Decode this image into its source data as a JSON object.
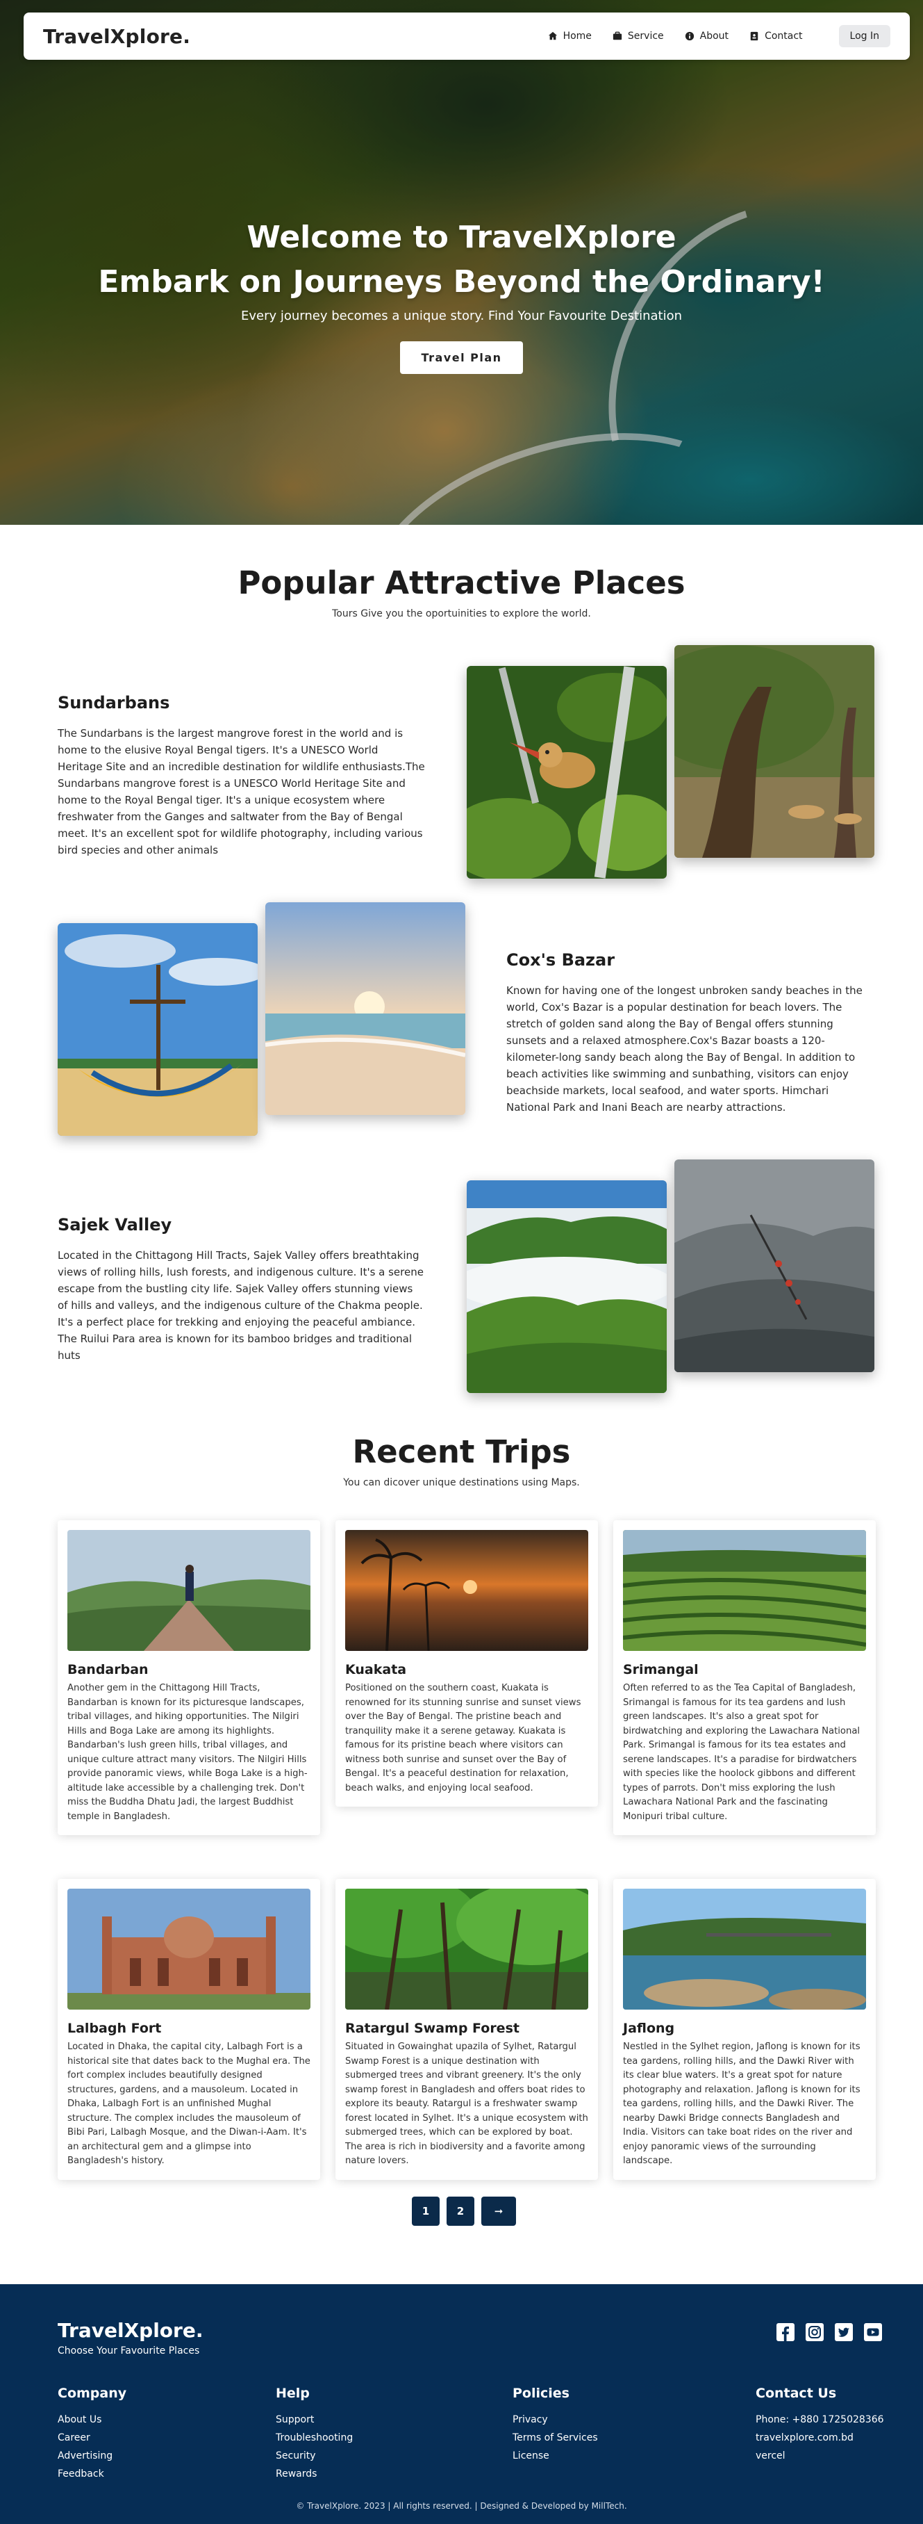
{
  "nav": {
    "brand": "TravelXplore.",
    "items": [
      "Home",
      "Service",
      "About",
      "Contact"
    ],
    "login": "Log In"
  },
  "hero": {
    "title_line1": "Welcome to TravelXplore",
    "title_line2": "Embark on Journeys Beyond the Ordinary!",
    "subtitle": "Every journey becomes a unique story. Find Your Favourite Destination",
    "cta": "Travel Plan"
  },
  "places_section": {
    "title": "Popular Attractive Places",
    "subtitle": "Tours Give you the oportuinities to explore the world.",
    "places": [
      {
        "name": "Sundarbans",
        "description": "The Sundarbans is the largest mangrove forest in the world and is home to the elusive Royal Bengal tigers. It's a UNESCO World Heritage Site and an incredible destination for wildlife enthusiasts.The Sundarbans mangrove forest is a UNESCO World Heritage Site and home to the Royal Bengal tiger. It's a unique ecosystem where freshwater from the Ganges and saltwater from the Bay of Bengal meet. It's an excellent spot for wildlife photography, including various bird species and other animals"
      },
      {
        "name": "Cox's Bazar",
        "description": "Known for having one of the longest unbroken sandy beaches in the world, Cox's Bazar is a popular destination for beach lovers. The stretch of golden sand along the Bay of Bengal offers stunning sunsets and a relaxed atmosphere.Cox's Bazar boasts a 120-kilometer-long sandy beach along the Bay of Bengal. In addition to beach activities like swimming and sunbathing, visitors can enjoy beachside markets, local seafood, and water sports. Himchari National Park and Inani Beach are nearby attractions."
      },
      {
        "name": "Sajek Valley",
        "description": "Located in the Chittagong Hill Tracts, Sajek Valley offers breathtaking views of rolling hills, lush forests, and indigenous culture. It's a serene escape from the bustling city life. Sajek Valley offers stunning views of hills and valleys, and the indigenous culture of the Chakma people. It's a perfect place for trekking and enjoying the peaceful ambiance. The Ruilui Para area is known for its bamboo bridges and traditional huts"
      }
    ]
  },
  "trips_section": {
    "title": "Recent Trips",
    "subtitle": "You can dicover unique destinations using Maps.",
    "trips": [
      {
        "name": "Bandarban",
        "description": " Another gem in the Chittagong Hill Tracts, Bandarban is known for its picturesque landscapes, tribal villages, and hiking opportunities. The Nilgiri Hills and Boga Lake are among its highlights. Bandarban's lush green hills, tribal villages, and unique culture attract many visitors. The Nilgiri Hills provide panoramic views, while Boga Lake is a high-altitude lake accessible by a challenging trek. Don't miss the Buddha Dhatu Jadi, the largest Buddhist temple in Bangladesh."
      },
      {
        "name": "Kuakata",
        "description": "Positioned on the southern coast, Kuakata is renowned for its stunning sunrise and sunset views over the Bay of Bengal. The pristine beach and tranquility make it a serene getaway. Kuakata is famous for its pristine beach where visitors can witness both sunrise and sunset over the Bay of Bengal. It's a peaceful destination for relaxation, beach walks, and enjoying local seafood."
      },
      {
        "name": "Srimangal",
        "description": "Often referred to as the Tea Capital of Bangladesh, Srimangal is famous for its tea gardens and lush green landscapes. It's also a great spot for birdwatching and exploring the Lawachara National Park. Srimangal is famous for its tea estates and serene landscapes. It's a paradise for birdwatchers with species like the hoolock gibbons and different types of parrots. Don't miss exploring the lush Lawachara National Park and the fascinating Monipuri tribal culture."
      },
      {
        "name": "Lalbagh Fort",
        "description": "Located in Dhaka, the capital city, Lalbagh Fort is a historical site that dates back to the Mughal era. The fort complex includes beautifully designed structures, gardens, and a mausoleum. Located in Dhaka, Lalbagh Fort is an unfinished Mughal structure. The complex includes the mausoleum of Bibi Pari, Lalbagh Mosque, and the Diwan-i-Aam. It's an architectural gem and a glimpse into Bangladesh's history."
      },
      {
        "name": "Ratargul Swamp Forest",
        "description": "Situated in Gowainghat upazila of Sylhet, Ratargul Swamp Forest is a unique destination with submerged trees and vibrant greenery. It's the only swamp forest in Bangladesh and offers boat rides to explore its beauty. Ratargul is a freshwater swamp forest located in Sylhet. It's a unique ecosystem with submerged trees, which can be explored by boat. The area is rich in biodiversity and a favorite among nature lovers."
      },
      {
        "name": "Jaflong",
        "description": "Nestled in the Sylhet region, Jaflong is known for its tea gardens, rolling hills, and the Dawki River with its clear blue waters. It's a great spot for nature photography and relaxation. Jaflong is known for its tea gardens, rolling hills, and the Dawki River. The nearby Dawki Bridge connects Bangladesh and India. Visitors can take boat rides on the river and enjoy panoramic views of the surrounding landscape."
      }
    ],
    "pagination": [
      "1",
      "2",
      "➞"
    ]
  },
  "footer": {
    "brand": "TravelXplore.",
    "tagline": "Choose Your Favourite Places",
    "social_icons": [
      "facebook-icon",
      "instagram-icon",
      "twitter-icon",
      "youtube-icon"
    ],
    "columns": [
      {
        "title": "Company",
        "links": [
          "About Us",
          "Career",
          "Advertising",
          "Feedback"
        ]
      },
      {
        "title": "Help",
        "links": [
          "Support",
          "Troubleshooting",
          "Security",
          "Rewards"
        ]
      },
      {
        "title": "Policies",
        "links": [
          "Privacy",
          "Terms of Services",
          "License"
        ]
      },
      {
        "title": "Contact Us",
        "links": [
          "Phone: +880 1725028366",
          "travelxplore.com.bd",
          "vercel"
        ]
      }
    ],
    "copyright": "© TravelXplore. 2023 | All rights reserved. | Designed & Developed by MillTech."
  },
  "colors": {
    "footer_bg": "#062d55",
    "pager_bg": "#0b2a4a",
    "login_bg": "#e9eaec"
  }
}
